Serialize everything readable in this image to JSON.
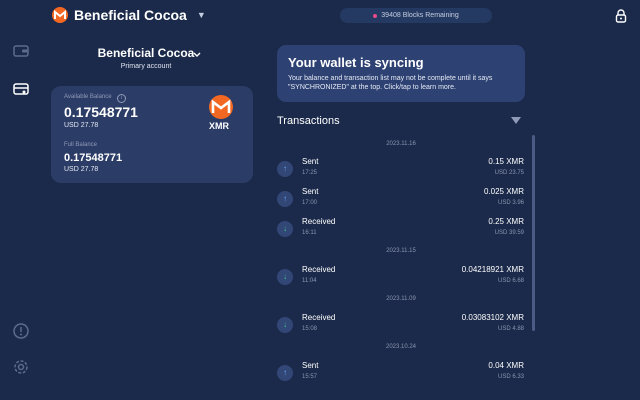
{
  "header": {
    "wallet_name": "Beneficial Cocoa",
    "sync_status": "39408 Blocks Remaining"
  },
  "account": {
    "name": "Beneficial Cocoa",
    "type": "Primary account"
  },
  "balance": {
    "available_label": "Available Balance",
    "available_xmr": "0.17548771",
    "available_usd": "USD 27.78",
    "full_label": "Full Balance",
    "full_xmr": "0.17548771",
    "full_usd": "USD 27.78",
    "currency": "XMR"
  },
  "sync_banner": {
    "title": "Your wallet is syncing",
    "message": "Your balance and transaction list may not be complete until it says \"SYNCHRONIZED\" at the top. Click/tap to learn more."
  },
  "transactions": {
    "title": "Transactions",
    "groups": [
      {
        "date": "2023.11.16",
        "items": [
          {
            "type": "Sent",
            "time": "17:25",
            "amount": "0.15 XMR",
            "usd": "USD 23.75",
            "dir": "sent"
          },
          {
            "type": "Sent",
            "time": "17:00",
            "amount": "0.025 XMR",
            "usd": "USD 3.96",
            "dir": "sent"
          },
          {
            "type": "Received",
            "time": "16:11",
            "amount": "0.25 XMR",
            "usd": "USD 39.59",
            "dir": "recv"
          }
        ]
      },
      {
        "date": "2023.11.15",
        "items": [
          {
            "type": "Received",
            "time": "11:04",
            "amount": "0.04218921 XMR",
            "usd": "USD 6.68",
            "dir": "recv"
          }
        ]
      },
      {
        "date": "2023.11.09",
        "items": [
          {
            "type": "Received",
            "time": "15:08",
            "amount": "0.03083102 XMR",
            "usd": "USD 4.88",
            "dir": "recv"
          }
        ]
      },
      {
        "date": "2023.10.24",
        "items": [
          {
            "type": "Sent",
            "time": "15:57",
            "amount": "0.04 XMR",
            "usd": "USD 6.33",
            "dir": "sent"
          }
        ]
      }
    ]
  },
  "colors": {
    "background": "#1b2a4a",
    "card": "#2b3c66",
    "banner": "#2d4173",
    "monero_orange": "#f26822",
    "received_green": "#39c58c",
    "sent_blue": "#6aa8ff"
  },
  "icons": {
    "sidebar": [
      "wallet-icon",
      "buy-sell-icon",
      "help-icon",
      "settings-icon"
    ],
    "header": [
      "monero-logo-icon",
      "chevron-down-icon",
      "lock-icon"
    ]
  }
}
